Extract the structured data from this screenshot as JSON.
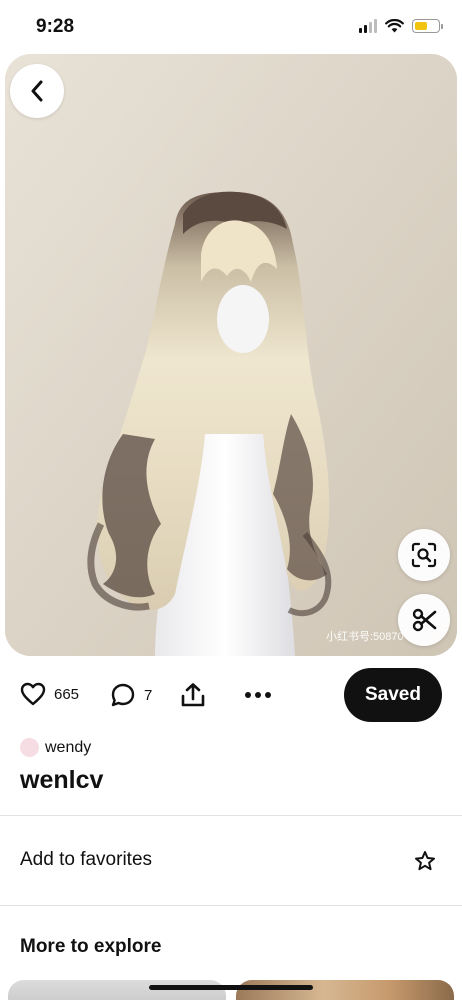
{
  "status_bar": {
    "time": "9:28"
  },
  "hero": {
    "watermark": "小红书号:50870"
  },
  "actions": {
    "likes": "665",
    "comments": "7",
    "saved_label": "Saved"
  },
  "pin": {
    "author": "wendy",
    "title": "wenlcv"
  },
  "favorites": {
    "label": "Add to favorites"
  },
  "explore": {
    "title": "More to explore"
  },
  "colors": {
    "accent": "#111111",
    "battery": "#f1c40f",
    "avatar": "#f6dde3"
  }
}
